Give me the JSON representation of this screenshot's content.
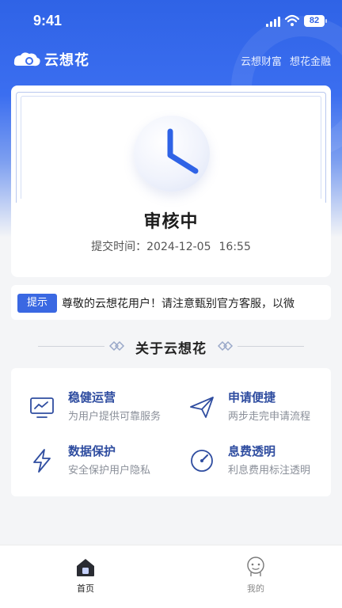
{
  "status_bar": {
    "time": "9:41",
    "battery": "82"
  },
  "header": {
    "brand_name": "云想花",
    "links": [
      "云想财富",
      "想花金融"
    ]
  },
  "status_card": {
    "status": "审核中",
    "submit_label": "提交时间：",
    "submit_date": "2024-12-05",
    "submit_time": "16:55"
  },
  "notice": {
    "tag": "提示",
    "text": "尊敬的云想花用户！请注意甄别官方客服，以微"
  },
  "about": {
    "title": "关于云想花"
  },
  "features": [
    {
      "icon": "monitor-chart-icon",
      "title": "稳健运营",
      "desc": "为用户提供可靠服务"
    },
    {
      "icon": "paper-plane-icon",
      "title": "申请便捷",
      "desc": "两步走完申请流程"
    },
    {
      "icon": "lightning-icon",
      "title": "数据保护",
      "desc": "安全保护用户隐私"
    },
    {
      "icon": "gauge-icon",
      "title": "息费透明",
      "desc": "利息费用标注透明"
    }
  ],
  "tabbar": {
    "tabs": [
      {
        "label": "首页",
        "icon": "home-icon",
        "active": true
      },
      {
        "label": "我的",
        "icon": "user-face-icon",
        "active": false
      }
    ]
  },
  "colors": {
    "primary": "#2f63e6",
    "feature_title": "#2f4da0",
    "tag": "#3a68e2"
  }
}
